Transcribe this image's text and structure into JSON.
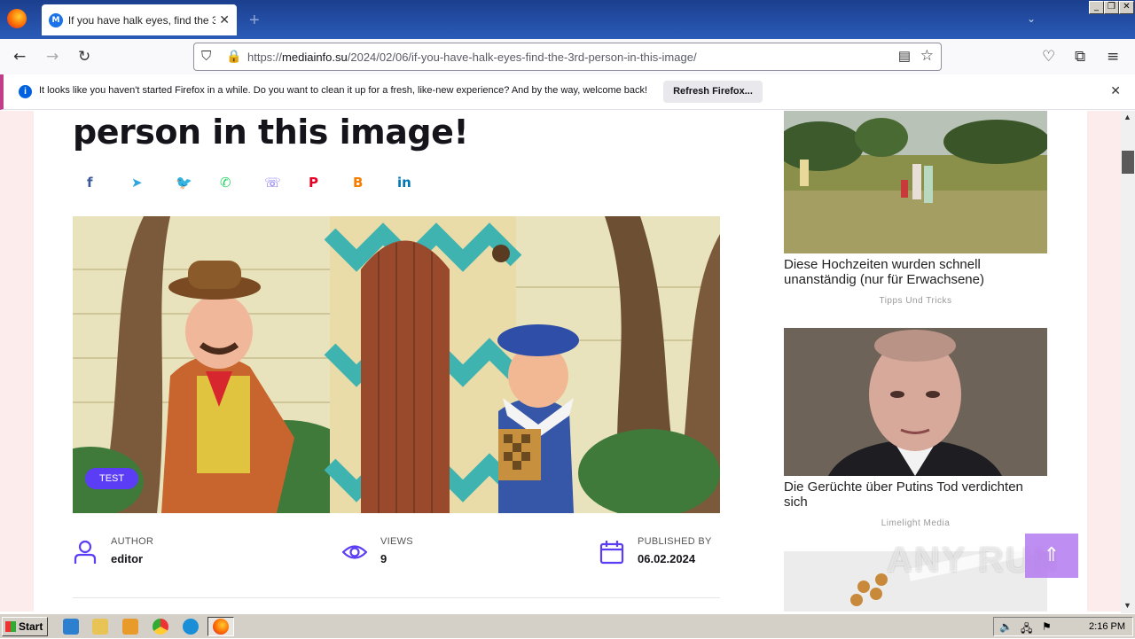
{
  "browser": {
    "tab_title": "If you have halk eyes, find the 3rd",
    "tab_favicon_letter": "M",
    "url_prefix": "https://",
    "url_domain": "mediainfo.su",
    "url_path": "/2024/02/06/if-you-have-halk-eyes-find-the-3rd-person-in-this-image/"
  },
  "notification": {
    "text": "It looks like you haven't started Firefox in a while. Do you want to clean it up for a fresh, like-new experience? And by the way, welcome back!",
    "button": "Refresh Firefox..."
  },
  "article": {
    "title_visible": "person in this image!",
    "badge": "TEST",
    "share_icons": [
      {
        "name": "facebook",
        "glyph": "f",
        "color": "#3b5998"
      },
      {
        "name": "telegram",
        "glyph": "➤",
        "color": "#2ca5e0"
      },
      {
        "name": "twitter",
        "glyph": "🐦",
        "color": "#1da1f2"
      },
      {
        "name": "whatsapp",
        "glyph": "✆",
        "color": "#25d366"
      },
      {
        "name": "viber",
        "glyph": "☏",
        "color": "#7360f2"
      },
      {
        "name": "pinterest",
        "glyph": "P",
        "color": "#e60023"
      },
      {
        "name": "blogger",
        "glyph": "B",
        "color": "#f57d00"
      },
      {
        "name": "linkedin",
        "glyph": "in",
        "color": "#0077b5"
      }
    ],
    "meta": {
      "author_label": "AUTHOR",
      "author_value": "editor",
      "views_label": "VIEWS",
      "views_value": "9",
      "published_label": "PUBLISHED BY",
      "published_value": "06.02.2024"
    }
  },
  "sidebar": {
    "cards": [
      {
        "title": "Diese Hochzeiten wurden schnell unanständig (nur für Erwachsene)",
        "source": "Tipps Und Tricks"
      },
      {
        "title": "Die Gerüchte über Putins Tod verdichten sich",
        "source": "Limelight Media"
      }
    ]
  },
  "watermark": "ANY RUN",
  "taskbar": {
    "start": "Start",
    "clock": "2:16 PM"
  },
  "colors": {
    "accent": "#5b3df5",
    "page_bg": "#fcecec"
  }
}
